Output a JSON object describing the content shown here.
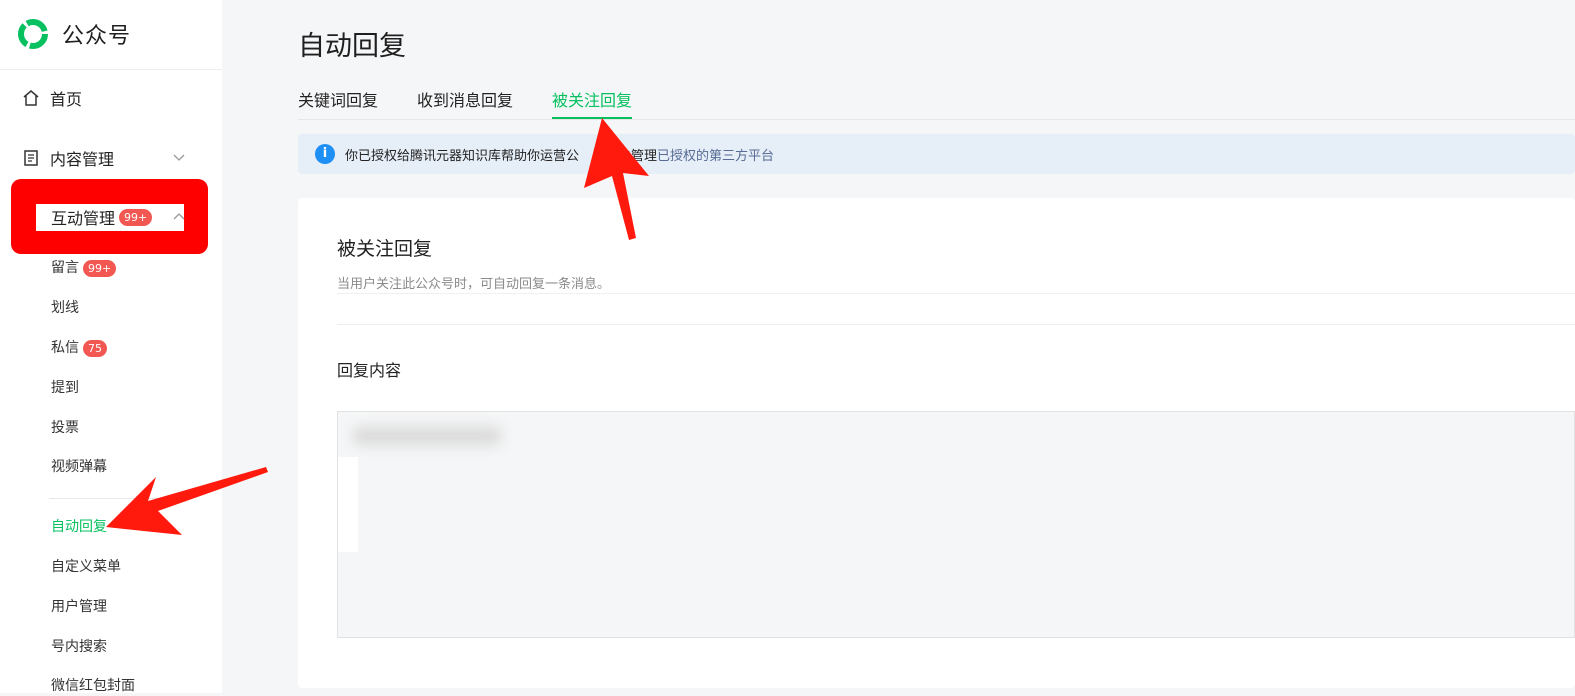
{
  "brand": {
    "name": "公众号",
    "logo_icon": "wechat-official-account-logo-icon",
    "color": "#07c160"
  },
  "sidebar": {
    "home": {
      "label": "首页",
      "icon": "home-icon"
    },
    "content": {
      "label": "内容管理",
      "icon": "document-icon"
    },
    "interaction": {
      "label": "互动管理",
      "badge": "99+"
    },
    "items": [
      {
        "label": "留言",
        "badge": "99+"
      },
      {
        "label": "划线"
      },
      {
        "label": "私信",
        "badge": "75"
      },
      {
        "label": "提到"
      },
      {
        "label": "投票"
      },
      {
        "label": "视频弹幕"
      },
      {
        "label": "自动回复",
        "active": true
      },
      {
        "label": "自定义菜单"
      },
      {
        "label": "用户管理"
      },
      {
        "label": "号内搜索"
      },
      {
        "label": "微信红包封面"
      }
    ]
  },
  "main": {
    "title": "自动回复",
    "tabs": [
      {
        "label": "关键词回复"
      },
      {
        "label": "收到消息回复"
      },
      {
        "label": "被关注回复",
        "active": true
      }
    ],
    "notice": {
      "text": "你已授权给腾讯元器知识库帮助你运营公",
      "action_text": "点击管理",
      "link_text": "已授权的第三方平台"
    },
    "card": {
      "title": "被关注回复",
      "description": "当用户关注此公众号时，可自动回复一条消息。",
      "reply_label": "回复内容"
    }
  },
  "colors": {
    "accent": "#07c160",
    "badge": "#f25751",
    "annotation": "#ff0000",
    "link": "#576b95",
    "info": "#1e8ff5"
  }
}
